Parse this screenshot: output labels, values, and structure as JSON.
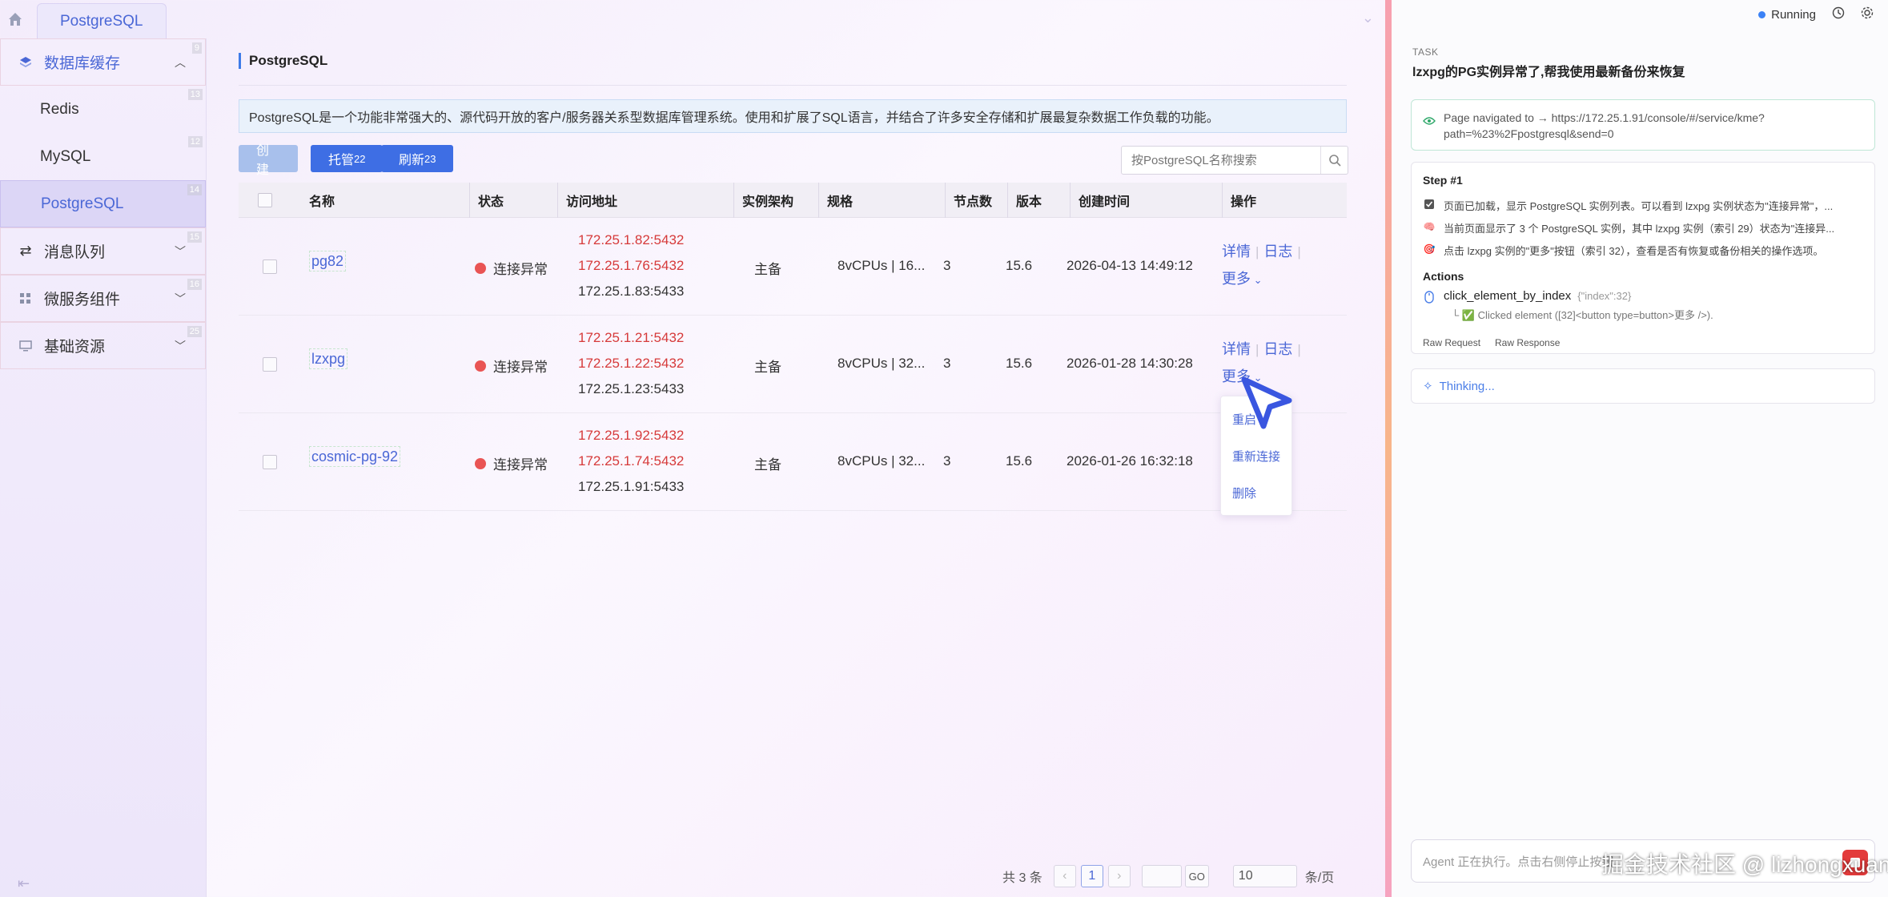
{
  "topbar": {
    "tab_label": "PostgreSQL"
  },
  "sidebar": {
    "groups": [
      {
        "label": "数据库缓存",
        "badge": "9"
      },
      {
        "label": "消息队列",
        "badge": "15"
      },
      {
        "label": "微服务组件",
        "badge": "16"
      },
      {
        "label": "基础资源",
        "badge": "25"
      }
    ],
    "items": [
      {
        "label": "Redis",
        "badge": "13"
      },
      {
        "label": "MySQL",
        "badge": "12"
      },
      {
        "label": "PostgreSQL",
        "badge": "14"
      }
    ]
  },
  "main": {
    "breadcrumb": "PostgreSQL",
    "info": "PostgreSQL是一个功能非常强大的、源代码开放的客户/服务器关系型数据库管理系统。使用和扩展了SQL语言，并结合了许多安全存储和扩展最复杂数据工作负载的功能。",
    "buttons": {
      "create": "创建",
      "host": "托管",
      "host_badge": "22",
      "refresh": "刷新",
      "refresh_badge": "23"
    },
    "search_placeholder": "按PostgreSQL名称搜索",
    "columns": [
      "名称",
      "状态",
      "访问地址",
      "实例架构",
      "规格",
      "节点数",
      "版本",
      "创建时间",
      "操作"
    ],
    "rows": [
      {
        "name": "pg82",
        "status": "连接异常",
        "addr1": "172.25.1.82:5432",
        "addr2": "172.25.1.76:5432",
        "addr3": "172.25.1.83:5433",
        "arch": "主备",
        "spec": "8vCPUs | 16...",
        "nodes": "3",
        "version": "15.6",
        "created": "2026-04-13 14:49:12"
      },
      {
        "name": "lzxpg",
        "status": "连接异常",
        "addr1": "172.25.1.21:5432",
        "addr2": "172.25.1.22:5432",
        "addr3": "172.25.1.23:5433",
        "arch": "主备",
        "spec": "8vCPUs | 32...",
        "nodes": "3",
        "version": "15.6",
        "created": "2026-01-28 14:30:28"
      },
      {
        "name": "cosmic-pg-92",
        "status": "连接异常",
        "addr1": "172.25.1.92:5432",
        "addr2": "172.25.1.74:5432",
        "addr3": "172.25.1.91:5433",
        "arch": "主备",
        "spec": "8vCPUs | 32...",
        "nodes": "3",
        "version": "15.6",
        "created": "2026-01-26 16:32:18"
      }
    ],
    "ops": {
      "detail": "详情",
      "log": "日志",
      "more": "更多"
    },
    "dropdown": [
      "重启",
      "重新连接",
      "删除"
    ],
    "pager": {
      "total": "共 3 条",
      "page": "1",
      "go": "GO",
      "size": "10",
      "unit": "条/页"
    }
  },
  "panel": {
    "status": "Running",
    "task_label": "TASK",
    "task_text": "lzxpg的PG实例异常了,帮我使用最新备份来恢复",
    "nav_text_1": "Page navigated to → https://172.25.1.91/console/#/service/kme?",
    "nav_text_2": "path=%23%2Fpostgresql&send=0",
    "step_title": "Step #1",
    "step_lines": [
      "页面已加载，显示 PostgreSQL 实例列表。可以看到 lzxpg 实例状态为\"连接异常\"，...",
      "当前页面显示了 3 个 PostgreSQL 实例，其中 lzxpg 实例（索引 29）状态为\"连接异...",
      "点击 lzxpg 实例的\"更多\"按钮（索引 32），查看是否有恢复或备份相关的操作选项。"
    ],
    "actions_title": "Actions",
    "action_name": "click_element_by_index",
    "action_args": "{\"index\":32}",
    "action_result": "└ ✅ Clicked element ([32]<button type=button>更多 />).",
    "raw_request": "Raw Request",
    "raw_response": "Raw Response",
    "thinking": "Thinking...",
    "chat_text": "Agent 正在执行。点击右侧停止按钮"
  },
  "watermark": "掘金技术社区 @ lizhongxuan"
}
